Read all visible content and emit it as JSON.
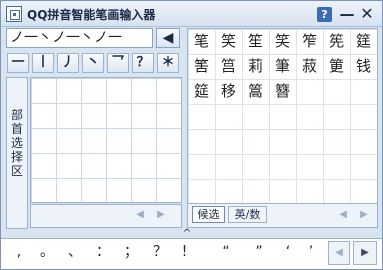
{
  "window": {
    "title": "QQ拼音智能笔画输入器",
    "help_label": "?",
    "minimize_label": "—",
    "close_label": "✕"
  },
  "input": {
    "value": "ノ一丶ノ一丶ノ一",
    "backspace_label": "◀"
  },
  "strokes": [
    "一",
    "丨",
    "丿",
    "丶",
    "乛",
    "？",
    "＊"
  ],
  "radical": {
    "label": "部首选择区"
  },
  "candidates": {
    "rows": [
      [
        "笔",
        "笑",
        "笙",
        "笑",
        "笮",
        "筅",
        "筳"
      ],
      [
        "筈",
        "筥",
        "莉",
        "筆",
        "菽",
        "筻",
        "钱"
      ],
      [
        "筵",
        "移",
        "篙",
        "簪"
      ]
    ],
    "tab_candidates": "候选",
    "tab_en_num": "英/数"
  },
  "nav": {
    "prev": "◀",
    "next": "▶",
    "expand": "^"
  },
  "punctuation": [
    ",",
    "。",
    "、",
    "：",
    "；",
    "？",
    "！",
    "“",
    "”",
    "‘",
    "’"
  ],
  "colors": {
    "frame": "#d9e4f1",
    "border": "#9cb2cf",
    "accent": "#3b6db4"
  }
}
